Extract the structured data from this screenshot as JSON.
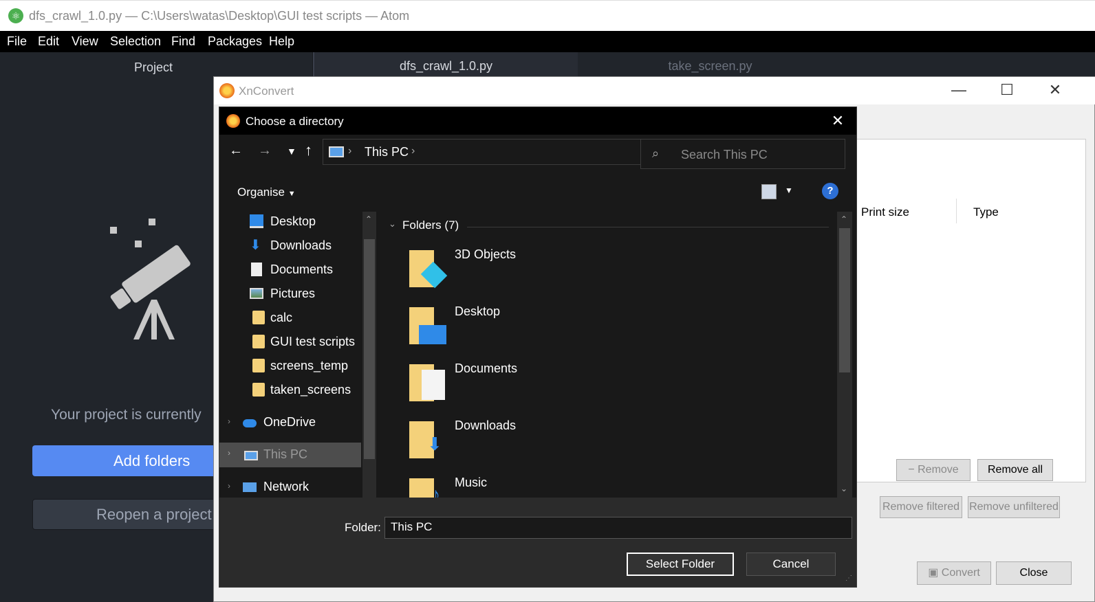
{
  "atom": {
    "title": "dfs_crawl_1.0.py — C:\\Users\\watas\\Desktop\\GUI test scripts — Atom",
    "menu": [
      "File",
      "Edit",
      "View",
      "Selection",
      "Find",
      "Packages",
      "Help"
    ],
    "project_tab": "Project",
    "tabs": [
      "dfs_crawl_1.0.py",
      "take_screen.py"
    ],
    "empty_text": "Your project is currently",
    "add_folders": "Add folders",
    "reopen": "Reopen a project"
  },
  "xnconvert": {
    "title": "XnConvert",
    "columns": [
      "Print size",
      "Type"
    ],
    "remove": "Remove",
    "remove_all": "Remove all",
    "remove_filtered": "Remove filtered",
    "remove_unfiltered": "Remove unfiltered",
    "convert": "Convert",
    "close": "Close"
  },
  "dialog": {
    "title": "Choose a directory",
    "path": "This PC",
    "search_placeholder": "Search This PC",
    "organise": "Organise",
    "nav": [
      {
        "label": "Desktop",
        "icon": "desktop-icon",
        "pinned": true
      },
      {
        "label": "Downloads",
        "icon": "download-icon",
        "pinned": true
      },
      {
        "label": "Documents",
        "icon": "documents-icon",
        "pinned": true
      },
      {
        "label": "Pictures",
        "icon": "pictures-icon",
        "pinned": true
      },
      {
        "label": "calc",
        "icon": "folder-icon",
        "pinned": false
      },
      {
        "label": "GUI test scripts",
        "icon": "folder-icon",
        "pinned": false
      },
      {
        "label": "screens_temp",
        "icon": "folder-icon",
        "pinned": false
      },
      {
        "label": "taken_screens",
        "icon": "folder-icon",
        "pinned": false
      }
    ],
    "onedrive": "OneDrive",
    "thispc": "This PC",
    "network": "Network",
    "group_label": "Folders",
    "group_count": "(7)",
    "folders": [
      "3D Objects",
      "Desktop",
      "Documents",
      "Downloads",
      "Music"
    ],
    "folder_label": "Folder:",
    "folder_value": "This PC",
    "select": "Select Folder",
    "cancel": "Cancel"
  }
}
